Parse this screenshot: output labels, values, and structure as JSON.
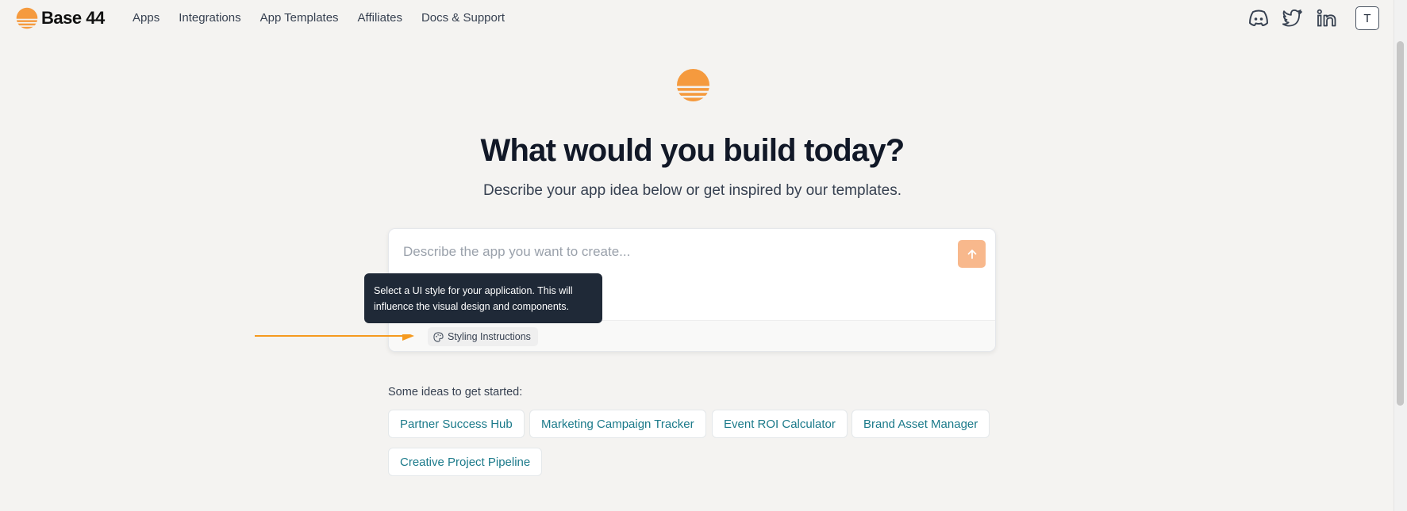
{
  "brand": {
    "name": "Base 44",
    "accent": "#f59a3e"
  },
  "nav": {
    "items": [
      {
        "label": "Apps"
      },
      {
        "label": "Integrations"
      },
      {
        "label": "App Templates"
      },
      {
        "label": "Affiliates"
      },
      {
        "label": "Docs & Support"
      }
    ]
  },
  "social": {
    "icons": [
      "discord-icon",
      "twitter-icon",
      "linkedin-icon"
    ]
  },
  "user": {
    "initial": "T"
  },
  "hero": {
    "title": "What would you build today?",
    "subtitle": "Describe your app idea below or get inspired by our templates."
  },
  "prompt": {
    "placeholder": "Describe the app you want to create...",
    "value": "",
    "styling_label": "Styling Instructions"
  },
  "tooltip": {
    "text": "Select a UI style for your application. This will influence the visual design and components."
  },
  "ideas": {
    "label": "Some ideas to get started:",
    "items": [
      {
        "label": "Partner Success Hub"
      },
      {
        "label": "Marketing Campaign Tracker"
      },
      {
        "label": "Event ROI Calculator"
      },
      {
        "label": "Brand Asset Manager"
      },
      {
        "label": "Creative Project Pipeline"
      }
    ]
  }
}
